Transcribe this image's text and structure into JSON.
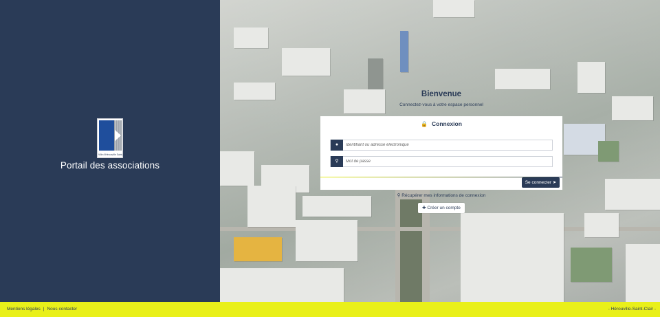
{
  "left_panel": {
    "logo_text": "Ville d'Hérouville Saint-Clair",
    "portal_title": "Portail des associations"
  },
  "welcome": {
    "title": "Bienvenue",
    "subtitle": "Connectez-vous à votre espace personnel"
  },
  "login": {
    "header_icon": "lock-icon",
    "header": "Connexion",
    "username_icon": "user-icon",
    "username_placeholder": "Identifiant ou adresse électronique",
    "username_value": "",
    "password_icon": "key-icon",
    "password_placeholder": "Mot de passe",
    "password_value": "",
    "submit_label": "Se connecter",
    "submit_icon": "sign-in-icon"
  },
  "recover": {
    "icon": "key-icon",
    "label": "Récupérer mes informations de connexion"
  },
  "create_account": {
    "icon": "user-plus-icon",
    "label": "Créer un compte"
  },
  "footer": {
    "legal_label": "Mentions légales",
    "separator": "|",
    "contact_label": "Nous contacter",
    "city_label": "- Hérouville-Saint-Clair -"
  },
  "colors": {
    "navy": "#2a3b57",
    "yellow": "#e9f01a",
    "lock": "#e3c419"
  }
}
